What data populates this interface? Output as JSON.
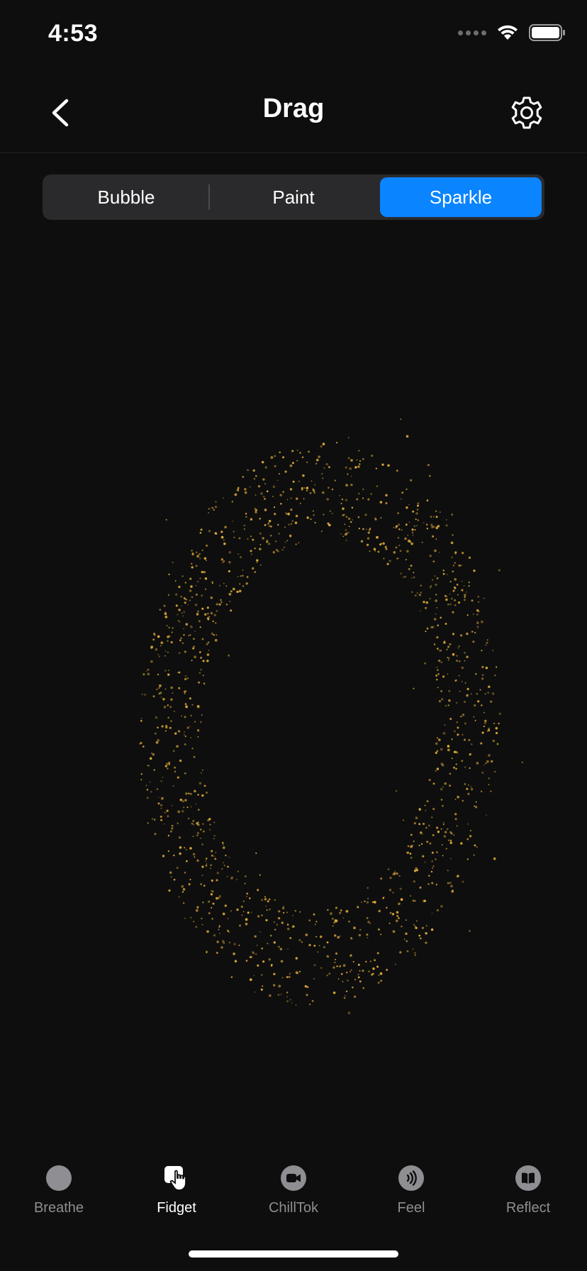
{
  "status_bar": {
    "time": "4:53"
  },
  "nav": {
    "title": "Drag"
  },
  "segments": [
    {
      "label": "Bubble",
      "selected": false
    },
    {
      "label": "Paint",
      "selected": false
    },
    {
      "label": "Sparkle",
      "selected": true
    }
  ],
  "tabs": [
    {
      "label": "Breathe",
      "icon": "breathe-icon",
      "active": false
    },
    {
      "label": "Fidget",
      "icon": "fidget-icon",
      "active": true
    },
    {
      "label": "ChillTok",
      "icon": "video-icon",
      "active": false
    },
    {
      "label": "Feel",
      "icon": "sound-waves-icon",
      "active": false
    },
    {
      "label": "Reflect",
      "icon": "book-icon",
      "active": false
    }
  ],
  "colors": {
    "background": "#0e0e0e",
    "accent": "#0a84ff",
    "sparkle": "#e8b33a",
    "inactive_tab": "#8e8e93"
  }
}
